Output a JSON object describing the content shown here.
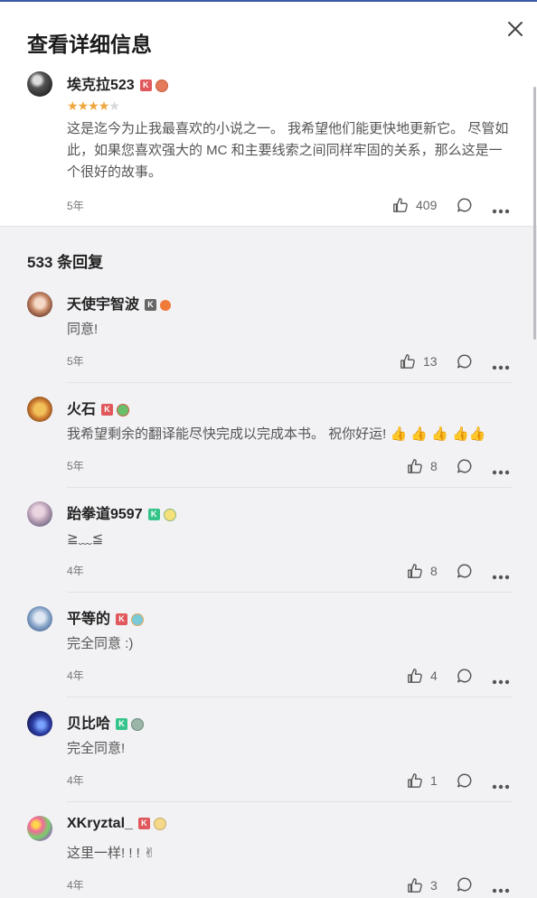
{
  "dialog": {
    "title": "查看详细信息"
  },
  "review": {
    "user": "埃克拉523",
    "rating_stars": 4,
    "rating_max": 5,
    "text": "这是迄今为止我最喜欢的小说之一。 我希望他们能更快地更新它。 尽管如此，如果您喜欢强大的 MC 和主要线索之间同样牢固的关系，那么这是一个很好的故事。",
    "age": "5年",
    "likes": "409"
  },
  "replies_header": "533 条回复",
  "comments": [
    {
      "user": "天使宇智波",
      "text": "同意!",
      "age": "5年",
      "likes": "13"
    },
    {
      "user": "火石",
      "text": "我希望剩余的翻译能尽快完成以完成本书。 祝你好运!  👍 👍 👍 👍👍",
      "age": "5年",
      "likes": "8"
    },
    {
      "user": "跆拳道9597",
      "text": "≧﹏≦",
      "age": "4年",
      "likes": "8"
    },
    {
      "user": "平等的",
      "text": "完全同意 :)",
      "age": "4年",
      "likes": "4"
    },
    {
      "user": "贝比哈",
      "text": "完全同意!",
      "age": "4年",
      "likes": "1"
    },
    {
      "user": "XKryztal_",
      "text": "这里一样! ! !  ✌",
      "age": "4年",
      "likes": "3"
    }
  ],
  "colors": {
    "star": "#f0a63a",
    "accent_top": "#3b5aa5",
    "badge_red": "#e0585b",
    "badge_green": "#35c48a"
  },
  "icons": {
    "close": "close-icon",
    "like": "thumbs-up-icon",
    "reply": "reply-bubble-icon",
    "more": "more-dots-icon"
  }
}
